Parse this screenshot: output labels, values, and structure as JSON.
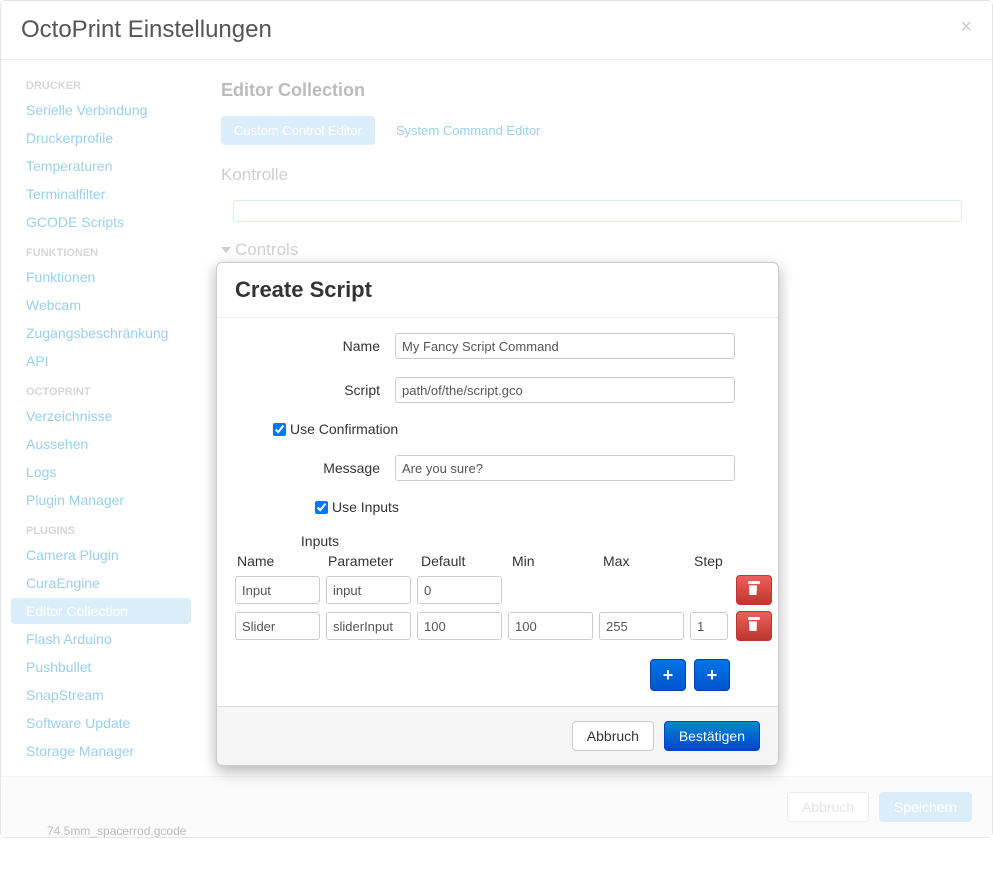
{
  "header": {
    "title": "OctoPrint Einstellungen"
  },
  "sidebar": {
    "groups": [
      {
        "heading": "Drucker",
        "items": [
          {
            "label": "Serielle Verbindung",
            "active": false
          },
          {
            "label": "Druckerprofile",
            "active": false
          },
          {
            "label": "Temperaturen",
            "active": false
          },
          {
            "label": "Terminalfilter",
            "active": false
          },
          {
            "label": "GCODE Scripts",
            "active": false
          }
        ]
      },
      {
        "heading": "Funktionen",
        "items": [
          {
            "label": "Funktionen",
            "active": false
          },
          {
            "label": "Webcam",
            "active": false
          },
          {
            "label": "Zugangsbeschränkung",
            "active": false
          },
          {
            "label": "API",
            "active": false
          }
        ]
      },
      {
        "heading": "OctoPrint",
        "items": [
          {
            "label": "Verzeichnisse",
            "active": false
          },
          {
            "label": "Aussehen",
            "active": false
          },
          {
            "label": "Logs",
            "active": false
          },
          {
            "label": "Plugin Manager",
            "active": false
          }
        ]
      },
      {
        "heading": "Plugins",
        "items": [
          {
            "label": "Camera Plugin",
            "active": false
          },
          {
            "label": "CuraEngine",
            "active": false
          },
          {
            "label": "Editor Collection",
            "active": true
          },
          {
            "label": "Flash Arduino",
            "active": false
          },
          {
            "label": "Pushbullet",
            "active": false
          },
          {
            "label": "SnapStream",
            "active": false
          },
          {
            "label": "Software Update",
            "active": false
          },
          {
            "label": "Storage Manager",
            "active": false
          }
        ]
      }
    ]
  },
  "main": {
    "section_title": "Editor Collection",
    "tabs": [
      {
        "label": "Custom Control Editor",
        "active": true
      },
      {
        "label": "System Command Editor",
        "active": false
      }
    ],
    "kontrolle_label": "Kontrolle",
    "controls_label": "Controls"
  },
  "settings_footer": {
    "cancel": "Abbruch",
    "save": "Speichern"
  },
  "modal": {
    "title": "Create Script",
    "name_label": "Name",
    "name_value": "My Fancy Script Command",
    "script_label": "Script",
    "script_value": "path/of/the/script.gco",
    "use_confirmation_label": "Use Confirmation",
    "use_confirmation_checked": true,
    "message_label": "Message",
    "message_value": "Are you sure?",
    "use_inputs_label": "Use Inputs",
    "use_inputs_checked": true,
    "inputs_heading": "Inputs",
    "columns": {
      "name": "Name",
      "parameter": "Parameter",
      "default": "Default",
      "min": "Min",
      "max": "Max",
      "step": "Step"
    },
    "rows": [
      {
        "name": "Input",
        "parameter": "input",
        "default": "0",
        "min": "",
        "max": "",
        "step": ""
      },
      {
        "name": "Slider",
        "parameter": "sliderInput",
        "default": "100",
        "min": "100",
        "max": "255",
        "step": "1"
      }
    ],
    "footer": {
      "cancel": "Abbruch",
      "confirm": "Bestätigen"
    }
  },
  "bottom_file": "74.5mm_spacerrod.gcode"
}
